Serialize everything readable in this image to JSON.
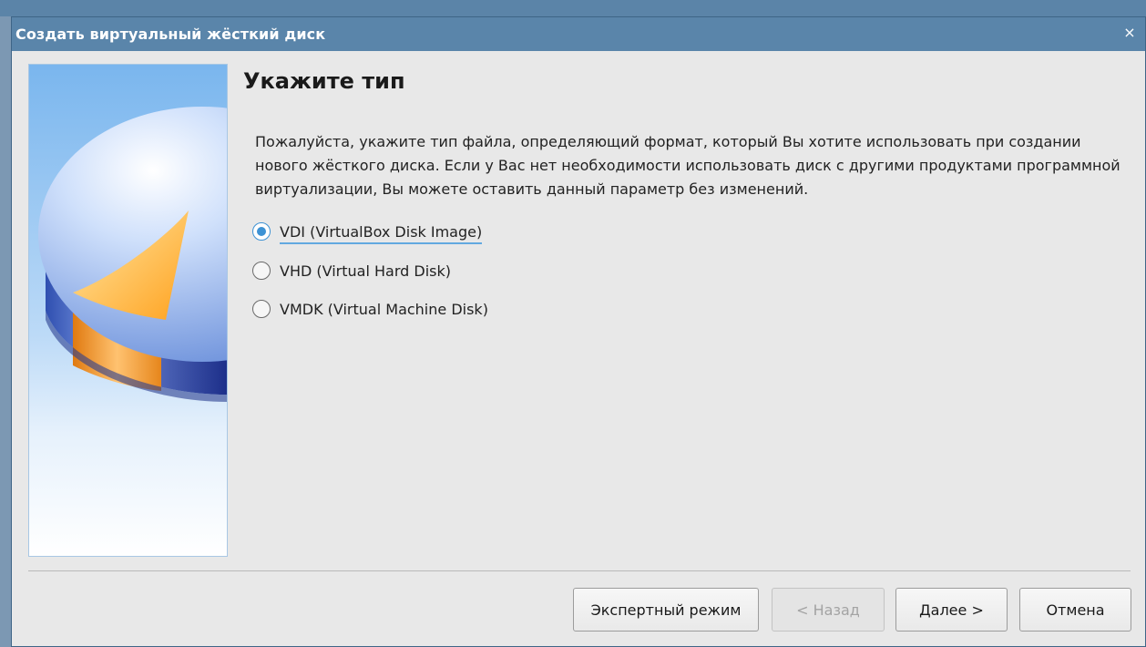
{
  "dialog": {
    "title": "Создать виртуальный жёсткий диск",
    "close_glyph": "×"
  },
  "page": {
    "heading": "Укажите тип",
    "description": "Пожалуйста, укажите тип файла, определяющий формат, который Вы хотите использовать при создании нового жёсткого диска. Если у Вас нет необходимости использовать диск с другими продуктами программной виртуализации, Вы можете оставить данный параметр без изменений."
  },
  "options": [
    {
      "label": "VDI (VirtualBox Disk Image)",
      "selected": true
    },
    {
      "label": "VHD (Virtual Hard Disk)",
      "selected": false
    },
    {
      "label": "VMDK (Virtual Machine Disk)",
      "selected": false
    }
  ],
  "buttons": {
    "expert": "Экспертный режим",
    "back": "< Назад",
    "next": "Далее >",
    "cancel": "Отмена"
  },
  "colors": {
    "titlebar": "#5a85aa",
    "accent": "#3d92d4"
  }
}
